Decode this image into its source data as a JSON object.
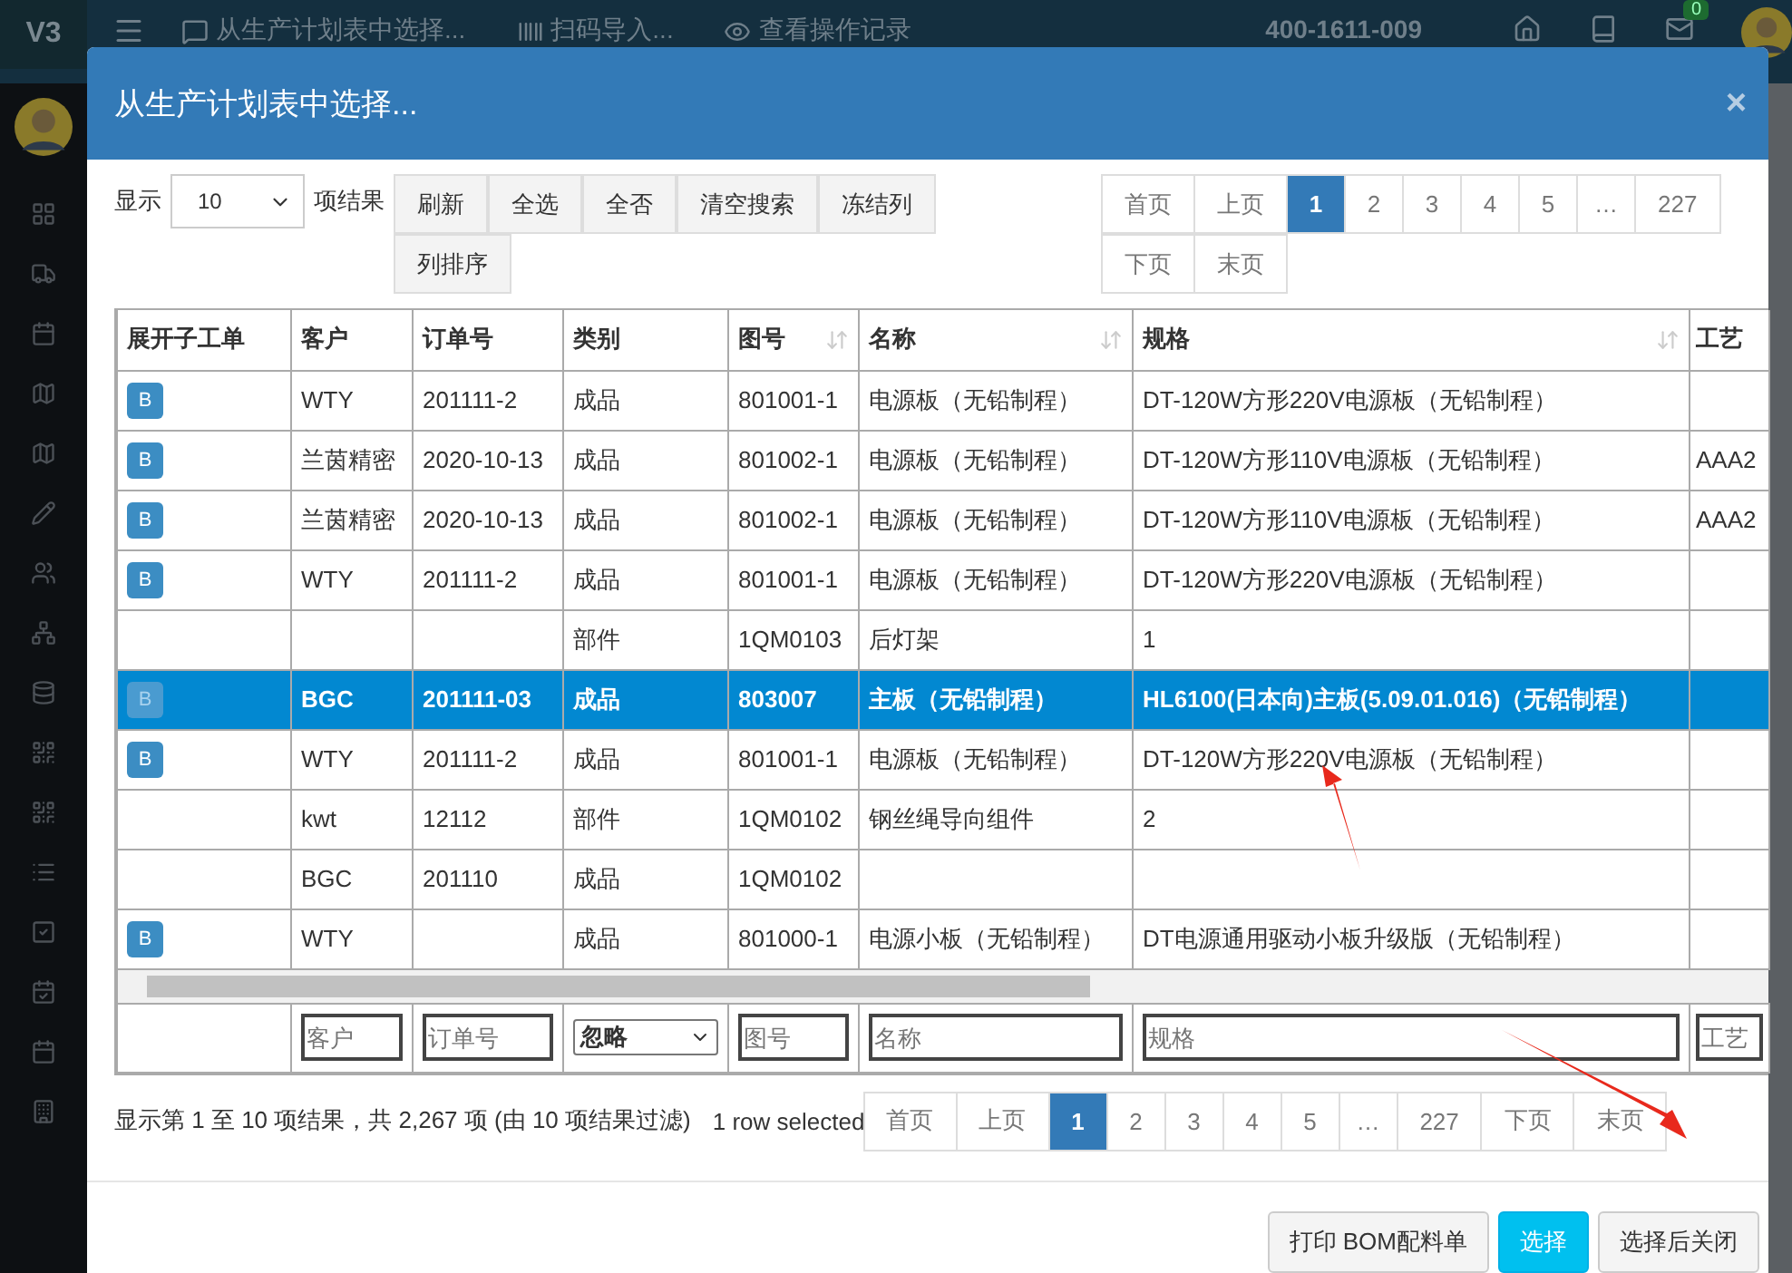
{
  "app": {
    "logo": "V3",
    "nav": [
      {
        "kind": "comment",
        "label": "从生产计划表中选择..."
      },
      {
        "kind": "barcode",
        "label": "扫码导入..."
      },
      {
        "kind": "eye",
        "label": "查看操作记录"
      }
    ],
    "phone": "400-1611-009",
    "mail_badge": "0"
  },
  "dialog": {
    "title": "从生产计划表中选择...",
    "close": "×",
    "length": {
      "prefix": "显示",
      "value": "10",
      "suffix": "项结果"
    },
    "tools": [
      "刷新",
      "全选",
      "全否",
      "清空搜索",
      "冻结列",
      "列排序"
    ],
    "pager_top": [
      {
        "label": "首页",
        "selected": false
      },
      {
        "label": "上页",
        "selected": false
      },
      {
        "label": "1",
        "selected": true
      },
      {
        "label": "2",
        "selected": false
      },
      {
        "label": "3",
        "selected": false
      },
      {
        "label": "4",
        "selected": false
      },
      {
        "label": "5",
        "selected": false
      },
      {
        "label": "…",
        "selected": false
      },
      {
        "label": "227",
        "selected": false
      },
      {
        "label": "下页",
        "selected": false
      },
      {
        "label": "末页",
        "selected": false
      }
    ],
    "table": {
      "columns": [
        {
          "label": "展开子工单",
          "sortable": false
        },
        {
          "label": "客户",
          "sortable": false
        },
        {
          "label": "订单号",
          "sortable": false
        },
        {
          "label": "类别",
          "sortable": false
        },
        {
          "label": "图号",
          "sortable": true
        },
        {
          "label": "名称",
          "sortable": true
        },
        {
          "label": "规格",
          "sortable": true
        },
        {
          "label": "工艺",
          "sortable": false
        }
      ],
      "rows": [
        {
          "cells": [
            "B",
            "WTY",
            "201111-2",
            "成品",
            "801001-1",
            "电源板（无铅制程）",
            "DT-120W方形220V电源板（无铅制程）",
            ""
          ],
          "selected": false
        },
        {
          "cells": [
            "B",
            "兰茵精密",
            "2020-10-13",
            "成品",
            "801002-1",
            "电源板（无铅制程）",
            "DT-120W方形110V电源板（无铅制程）",
            "AAA2"
          ],
          "selected": false
        },
        {
          "cells": [
            "B",
            "兰茵精密",
            "2020-10-13",
            "成品",
            "801002-1",
            "电源板（无铅制程）",
            "DT-120W方形110V电源板（无铅制程）",
            "AAA2"
          ],
          "selected": false
        },
        {
          "cells": [
            "B",
            "WTY",
            "201111-2",
            "成品",
            "801001-1",
            "电源板（无铅制程）",
            "DT-120W方形220V电源板（无铅制程）",
            ""
          ],
          "selected": false
        },
        {
          "cells": [
            "",
            "",
            "",
            "部件",
            "1QM0103",
            "后灯架",
            "1",
            ""
          ],
          "selected": false
        },
        {
          "cells": [
            "B",
            "BGC",
            "201111-03",
            "成品",
            "803007",
            "主板（无铅制程）",
            "HL6100(日本向)主板(5.09.01.016)（无铅制程）",
            ""
          ],
          "selected": true
        },
        {
          "cells": [
            "B",
            "WTY",
            "201111-2",
            "成品",
            "801001-1",
            "电源板（无铅制程）",
            "DT-120W方形220V电源板（无铅制程）",
            ""
          ],
          "selected": false
        },
        {
          "cells": [
            "",
            "kwt",
            "12112",
            "部件",
            "1QM0102",
            "钢丝绳导向组件",
            "2",
            ""
          ],
          "selected": false
        },
        {
          "cells": [
            "",
            "BGC",
            "201110",
            "成品",
            "1QM0102",
            "",
            "",
            ""
          ],
          "selected": false
        },
        {
          "cells": [
            "B",
            "WTY",
            "",
            "成品",
            "801000-1",
            "电源小板（无铅制程）",
            "DT电源通用驱动小板升级版（无铅制程）",
            ""
          ],
          "selected": false
        }
      ],
      "filters": [
        {
          "kind": "none"
        },
        {
          "kind": "input",
          "placeholder": "客户"
        },
        {
          "kind": "input",
          "placeholder": "订单号"
        },
        {
          "kind": "select",
          "value": "忽略"
        },
        {
          "kind": "input",
          "placeholder": "图号"
        },
        {
          "kind": "input",
          "placeholder": "名称"
        },
        {
          "kind": "input",
          "placeholder": "规格"
        },
        {
          "kind": "input",
          "placeholder": "工艺"
        }
      ]
    },
    "info": "显示第 1 至 10 项结果，共 2,267 项 (由 10 项结果过滤)",
    "selection_info": "1 row selected",
    "pager_bottom": [
      {
        "label": "首页",
        "selected": false
      },
      {
        "label": "上页",
        "selected": false
      },
      {
        "label": "1",
        "selected": true
      },
      {
        "label": "2",
        "selected": false
      },
      {
        "label": "3",
        "selected": false
      },
      {
        "label": "4",
        "selected": false
      },
      {
        "label": "5",
        "selected": false
      },
      {
        "label": "…",
        "selected": false
      },
      {
        "label": "227",
        "selected": false
      },
      {
        "label": "下页",
        "selected": false
      },
      {
        "label": "末页",
        "selected": false
      }
    ],
    "buttons": [
      {
        "label": "打印 BOM配料单",
        "kind": "default"
      },
      {
        "label": "选择",
        "kind": "primary"
      },
      {
        "label": "选择后关闭",
        "kind": "default"
      }
    ]
  }
}
